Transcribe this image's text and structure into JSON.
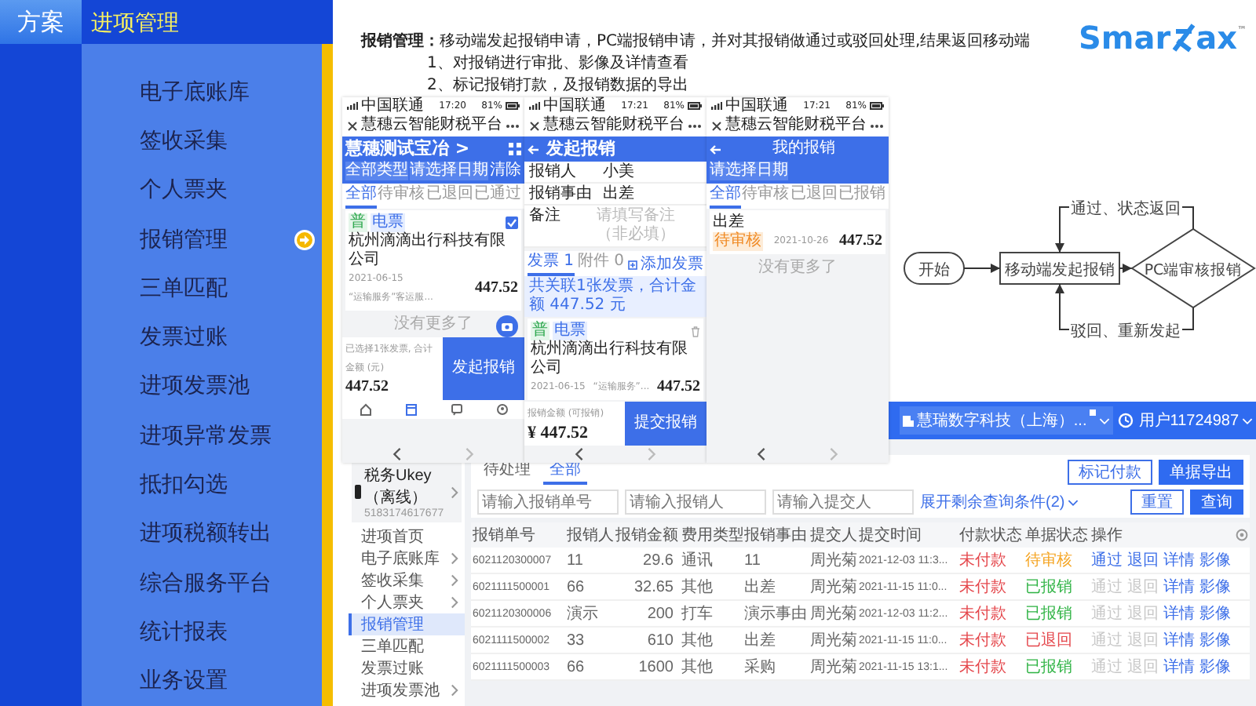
{
  "left_tab": "方案",
  "section_title": "进项管理",
  "menu": [
    {
      "label": "电子底账库",
      "selected": false
    },
    {
      "label": "签收采集",
      "selected": false
    },
    {
      "label": "个人票夹",
      "selected": false
    },
    {
      "label": "报销管理",
      "selected": true
    },
    {
      "label": "三单匹配",
      "selected": false
    },
    {
      "label": "发票过账",
      "selected": false
    },
    {
      "label": "进项发票池",
      "selected": false
    },
    {
      "label": "进项异常发票",
      "selected": false
    },
    {
      "label": "抵扣勾选",
      "selected": false
    },
    {
      "label": "进项税额转出",
      "selected": false
    },
    {
      "label": "综合服务平台",
      "selected": false
    },
    {
      "label": "统计报表",
      "selected": false
    },
    {
      "label": "业务设置",
      "selected": false
    }
  ],
  "description": {
    "lead": "**报销管理：**移动端发起报销申请，PC端报销申请，并对其报销做通过或驳回处理,结果返回移动端",
    "points": [
      "1、对报销进行审批、影像及详情查看",
      "2、标记报销打款，及报销数据的导出"
    ]
  },
  "logo": {
    "left": "Smar",
    "right": "ax",
    "mark": "™"
  },
  "phones": [
    {
      "kind": "invoice_list",
      "carrier": "中国联通",
      "time": "17:20",
      "battery": "81%",
      "title": "慧穗云智能财税平台",
      "header": "慧穗测试宝冶 >",
      "filters": [
        "全部类型",
        "请选择日期"
      ],
      "clear": "清除",
      "tabs": [
        {
          "label": "全部",
          "selected": true
        },
        {
          "label": "待审核",
          "selected": false
        },
        {
          "label": "已退回",
          "selected": false
        },
        {
          "label": "已通过",
          "selected": false
        }
      ],
      "card": {
        "tags": [
          "普",
          "电票"
        ],
        "company": "杭州滴滴出行科技有限公司",
        "checked": true,
        "date": "2021-06-15",
        "note": "“运输服务”客运服...",
        "amount": "447.52"
      },
      "end": "没有更多了",
      "summary": "已选择1张发票, 合计金额 (元)",
      "total": "447.52",
      "button": "发起报销"
    },
    {
      "kind": "new_claim",
      "carrier": "中国联通",
      "time": "17:21",
      "battery": "81%",
      "title": "慧穗云智能财税平台",
      "header": "发起报销",
      "form": [
        {
          "label": "报销人",
          "value": "小美"
        },
        {
          "label": "报销事由",
          "value": "出差"
        },
        {
          "label": "备注",
          "placeholder": "请填写备注（非必填）"
        }
      ],
      "tabs": [
        {
          "label": "发票 1",
          "selected": true
        },
        {
          "label": "附件 0",
          "selected": false
        }
      ],
      "add": "添加发票",
      "info": "共关联1张发票，合计金额 447.52 元",
      "card": {
        "tags": [
          "普",
          "电票"
        ],
        "company": "杭州滴滴出行科技有限公司",
        "date": "2021-06-15",
        "note": "“运输服务”...",
        "amount": "447.52"
      },
      "total_label": "报销金额 (可报销)",
      "total": "¥ 447.52",
      "button": "提交报销"
    },
    {
      "kind": "my_claims",
      "carrier": "中国联通",
      "time": "17:21",
      "battery": "81%",
      "title": "慧穗云智能财税平台",
      "header": "我的报销",
      "filters": [
        "请选择日期"
      ],
      "tabs": [
        {
          "label": "全部",
          "selected": true
        },
        {
          "label": "待审核",
          "selected": false
        },
        {
          "label": "已退回",
          "selected": false
        },
        {
          "label": "已报销",
          "selected": false
        }
      ],
      "card": {
        "reason": "出差",
        "status": "待审核",
        "date": "2021-10-26",
        "amount": "447.52"
      },
      "end": "没有更多了"
    }
  ],
  "flow": {
    "start": "开始",
    "process": "移动端发起报销",
    "decision": "PC端审核报销",
    "approve": "通过、状态返回",
    "reject": "驳回、重新发起"
  },
  "pc": {
    "company": "慧瑞数字科技（上海）...",
    "user": "用户11724987",
    "device": {
      "name": "税务Ukey（离线）",
      "serial": "5183174617677"
    },
    "sidebar": [
      {
        "label": "进项首页",
        "expandable": false,
        "selected": false
      },
      {
        "label": "电子底账库",
        "expandable": true,
        "selected": false
      },
      {
        "label": "签收采集",
        "expandable": true,
        "selected": false
      },
      {
        "label": "个人票夹",
        "expandable": true,
        "selected": false
      },
      {
        "label": "报销管理",
        "expandable": false,
        "selected": true
      },
      {
        "label": "三单匹配",
        "expandable": false,
        "selected": false
      },
      {
        "label": "发票过账",
        "expandable": false,
        "selected": false
      },
      {
        "label": "进项发票池",
        "expandable": true,
        "selected": false
      }
    ],
    "tabs": [
      {
        "label": "待处理",
        "selected": false
      },
      {
        "label": "全部",
        "selected": true
      }
    ],
    "top_buttons": [
      "标记付款",
      "单据导出"
    ],
    "filters": [
      {
        "placeholder": "请输入报销单号"
      },
      {
        "placeholder": "请输入报销人"
      },
      {
        "placeholder": "请输入提交人"
      }
    ],
    "more_filters": "展开剩余查询条件(2)",
    "buttons": [
      "重置",
      "查询"
    ],
    "table": {
      "columns": [
        "报销单号",
        "报销人",
        "报销金额",
        "费用类型",
        "报销事由",
        "提交人",
        "提交时间",
        "付款状态",
        "单据状态",
        "操作"
      ],
      "rows": [
        {
          "number": "6021120300007",
          "person": "11",
          "amount": "29.6",
          "type": "通讯",
          "reason": "11",
          "submitter": "周光菊",
          "time": "2021-12-03 11:3...",
          "pay": {
            "text": "未付款",
            "color": "#e5484d"
          },
          "doc": {
            "text": "待审核",
            "color": "#f5a524"
          },
          "actions": [
            {
              "label": "通过",
              "disabled": false
            },
            {
              "label": "退回",
              "disabled": false
            },
            {
              "label": "详情",
              "disabled": false
            },
            {
              "label": "影像",
              "disabled": false
            }
          ]
        },
        {
          "number": "6021111500001",
          "person": "66",
          "amount": "32.65",
          "type": "其他",
          "reason": "出差",
          "submitter": "周光菊",
          "time": "2021-11-15 11:0...",
          "pay": {
            "text": "未付款",
            "color": "#e5484d"
          },
          "doc": {
            "text": "已报销",
            "color": "#2fb344"
          },
          "actions": [
            {
              "label": "通过",
              "disabled": true
            },
            {
              "label": "退回",
              "disabled": true
            },
            {
              "label": "详情",
              "disabled": false
            },
            {
              "label": "影像",
              "disabled": false
            }
          ]
        },
        {
          "number": "6021120300006",
          "person": "演示",
          "amount": "200",
          "type": "打车",
          "reason": "演示事由",
          "submitter": "周光菊",
          "time": "2021-12-03 11:2...",
          "pay": {
            "text": "未付款",
            "color": "#e5484d"
          },
          "doc": {
            "text": "已报销",
            "color": "#2fb344"
          },
          "actions": [
            {
              "label": "通过",
              "disabled": true
            },
            {
              "label": "退回",
              "disabled": true
            },
            {
              "label": "详情",
              "disabled": false
            },
            {
              "label": "影像",
              "disabled": false
            }
          ]
        },
        {
          "number": "6021111500002",
          "person": "33",
          "amount": "610",
          "type": "其他",
          "reason": "出差",
          "submitter": "周光菊",
          "time": "2021-11-15 11:0...",
          "pay": {
            "text": "未付款",
            "color": "#e5484d"
          },
          "doc": {
            "text": "已退回",
            "color": "#e5484d"
          },
          "actions": [
            {
              "label": "通过",
              "disabled": true
            },
            {
              "label": "退回",
              "disabled": true
            },
            {
              "label": "详情",
              "disabled": false
            },
            {
              "label": "影像",
              "disabled": false
            }
          ]
        },
        {
          "number": "6021111500003",
          "person": "66",
          "amount": "1600",
          "type": "其他",
          "reason": "采购",
          "submitter": "周光菊",
          "time": "2021-11-15 13:1...",
          "pay": {
            "text": "未付款",
            "color": "#e5484d"
          },
          "doc": {
            "text": "已报销",
            "color": "#2fb344"
          },
          "actions": [
            {
              "label": "通过",
              "disabled": true
            },
            {
              "label": "退回",
              "disabled": true
            },
            {
              "label": "详情",
              "disabled": false
            },
            {
              "label": "影像",
              "disabled": false
            }
          ]
        }
      ]
    }
  }
}
